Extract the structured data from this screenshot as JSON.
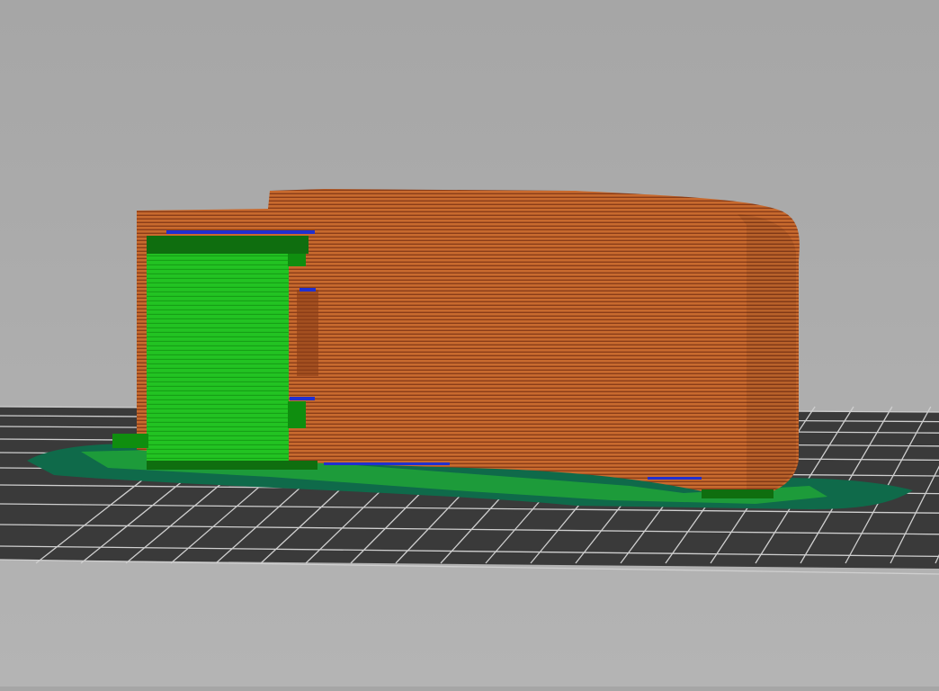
{
  "viewport": {
    "type": "gcode-preview-3d",
    "colors": {
      "background_top": "#a6a6a6",
      "background_bottom": "#b4b4b4",
      "bed": "#3a3a3a",
      "bed_grid": "#d0d0d0",
      "perimeter": "#c86a2e",
      "perimeter_dark": "#8a3d18",
      "support": "#22c322",
      "support_dark": "#0f6e0f",
      "skirt": "#0f6a4a",
      "bridge": "#2030d0",
      "overhang": "#a03030"
    }
  }
}
